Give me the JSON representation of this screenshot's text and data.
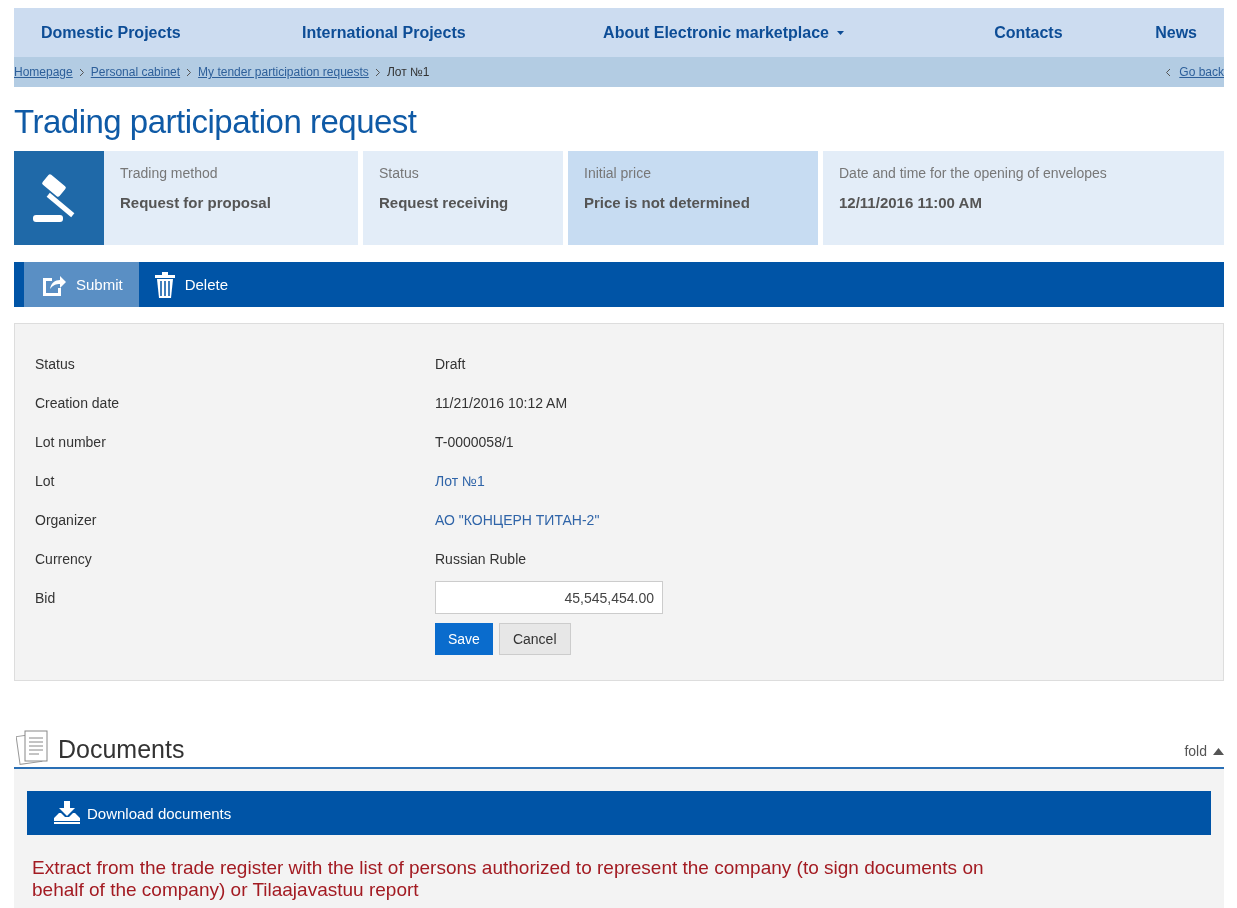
{
  "nav": {
    "items": [
      {
        "label": "Domestic Projects",
        "dropdown": false
      },
      {
        "label": "International Projects",
        "dropdown": false
      },
      {
        "label": "About Electronic marketplace",
        "dropdown": true
      },
      {
        "label": "Contacts",
        "dropdown": false
      },
      {
        "label": "News",
        "dropdown": false
      }
    ]
  },
  "breadcrumb": {
    "items": [
      {
        "label": "Homepage",
        "link": true
      },
      {
        "label": "Personal cabinet",
        "link": true
      },
      {
        "label": "My tender participation requests",
        "link": true
      },
      {
        "label": "Лот №1",
        "link": false
      }
    ],
    "back": "Go back"
  },
  "page_title": "Trading participation request",
  "summary": [
    {
      "label": "Trading method",
      "value": "Request for proposal",
      "highlighted": false
    },
    {
      "label": "Status",
      "value": "Request receiving",
      "highlighted": false
    },
    {
      "label": "Initial price",
      "value": "Price is not determined",
      "highlighted": true
    },
    {
      "label": "Date and time for the opening of envelopes",
      "value": "12/11/2016 11:00 AM",
      "highlighted": false
    }
  ],
  "toolbar": [
    {
      "label": "Submit",
      "kind": "submit",
      "active": true
    },
    {
      "label": "Delete",
      "kind": "delete",
      "active": false
    }
  ],
  "form": {
    "rows": [
      {
        "label": "Status",
        "value": "Draft",
        "kind": "text"
      },
      {
        "label": "Creation date",
        "value": "11/21/2016 10:12 AM",
        "kind": "text"
      },
      {
        "label": "Lot number",
        "value": "T-0000058/1",
        "kind": "text"
      },
      {
        "label": "Lot",
        "value": "Лот №1",
        "kind": "link"
      },
      {
        "label": "Organizer",
        "value": "АО \"КОНЦЕРН ТИТАН-2\"",
        "kind": "link"
      },
      {
        "label": "Currency",
        "value": "Russian Ruble",
        "kind": "text"
      },
      {
        "label": "Bid",
        "value": "45,545,454.00",
        "kind": "input"
      }
    ],
    "buttons": [
      {
        "label": "Save",
        "kind": "primary"
      },
      {
        "label": "Cancel",
        "kind": "secondary"
      }
    ]
  },
  "documents": {
    "title": "Documents",
    "fold": "fold",
    "expanded": true,
    "download": "Download documents",
    "notice": "Extract from the trade register with the list of persons authorized to represent the company (to sign documents on behalf of the company) or Tilaajavastuu report"
  }
}
